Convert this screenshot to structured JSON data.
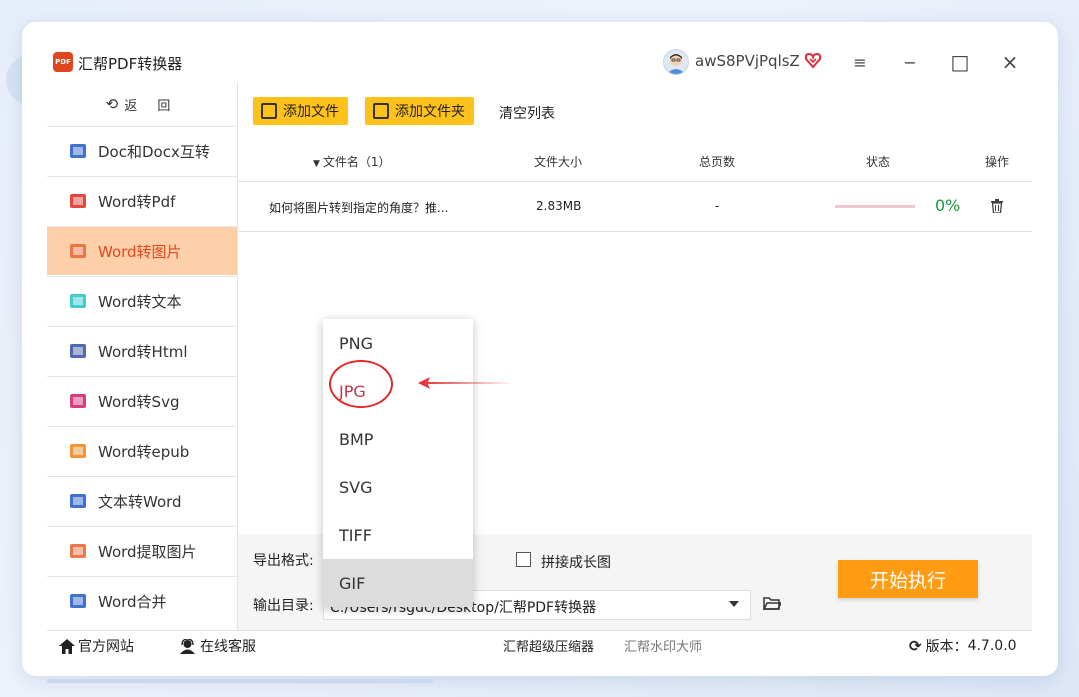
{
  "app": {
    "title": "汇帮PDF转换器",
    "logo_text": "PDF",
    "username": "awS8PVjPqlsZ"
  },
  "window_controls": {
    "menu": "≡",
    "minimize": "−",
    "maximize": "□",
    "close": "×"
  },
  "sidebar": {
    "back_label": "返 回",
    "items": [
      {
        "label": "Doc和Docx互转",
        "icon": "word-doc-icon",
        "color": "#2b62c8"
      },
      {
        "label": "Word转Pdf",
        "icon": "pdf-icon",
        "color": "#e0332a"
      },
      {
        "label": "Word转图片",
        "icon": "image-icon",
        "color": "#e86b3a",
        "active": true
      },
      {
        "label": "Word转文本",
        "icon": "text-file-icon",
        "color": "#2fc7c7"
      },
      {
        "label": "Word转Html",
        "icon": "html-icon",
        "color": "#3c5aa6"
      },
      {
        "label": "Word转Svg",
        "icon": "svg-image-icon",
        "color": "#d4286f"
      },
      {
        "label": "Word转epub",
        "icon": "epub-icon",
        "color": "#f08a23"
      },
      {
        "label": "文本转Word",
        "icon": "text-to-word-icon",
        "color": "#2b62c8"
      },
      {
        "label": "Word提取图片",
        "icon": "extract-image-icon",
        "color": "#e86b3a"
      },
      {
        "label": "Word合并",
        "icon": "word-merge-icon",
        "color": "#2b62c8"
      }
    ]
  },
  "toolbar": {
    "add_file": "添加文件",
    "add_folder": "添加文件夹",
    "clear_list": "清空列表"
  },
  "table": {
    "headers": {
      "filename": "文件名（1）",
      "size": "文件大小",
      "pages": "总页数",
      "status": "状态",
      "action": "操作"
    },
    "rows": [
      {
        "filename": "如何将图片转到指定的角度？推...",
        "size": "2.83MB",
        "pages": "-",
        "progress_pct": "0%",
        "progress": 0
      }
    ]
  },
  "settings": {
    "export_format_label": "导出格式:",
    "stitch_label": "拼接成长图",
    "stitch_checked": false,
    "output_dir_label": "输出目录:",
    "output_dir_value": "C:/Users/rsgdc/Desktop/汇帮PDF转换器",
    "start_button": "开始执行"
  },
  "format_dropdown": {
    "options": [
      "PNG",
      "JPG",
      "BMP",
      "SVG",
      "TIFF",
      "GIF"
    ],
    "selected": "GIF",
    "highlighted": "JPG"
  },
  "footer": {
    "website": "官方网站",
    "support": "在线客服",
    "compressor": "汇帮超级压缩器",
    "watermark": "汇帮水印大师",
    "version_label": "版本：",
    "version": "4.7.0.0"
  },
  "colors": {
    "accent_orange": "#ff9c12",
    "button_yellow": "#ffc21b",
    "active_bg": "#fdd0aa",
    "active_text": "#e6461f",
    "progress_green": "#1a9a3a",
    "annotation_red": "#e02b2b"
  }
}
